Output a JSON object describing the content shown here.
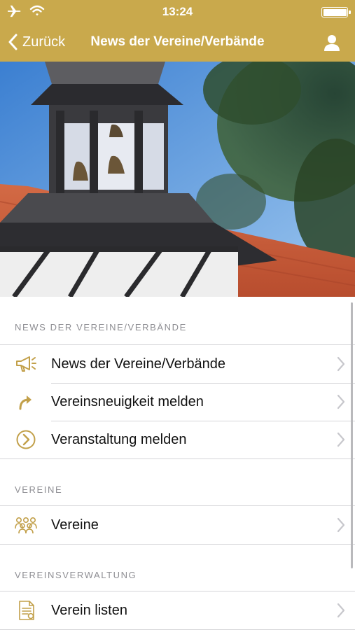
{
  "status_bar": {
    "time": "13:24"
  },
  "nav": {
    "back_label": "Zurück",
    "title": "News der Vereine/Verbände"
  },
  "colors": {
    "brand_gold": "#c9a94c",
    "icon_gold": "#c2a04a",
    "chevron": "#c7c7cc",
    "section_text": "#8e8e93"
  },
  "sections": [
    {
      "header": "NEWS DER VEREINE/VERBÄNDE",
      "items": [
        {
          "label": "News der Vereine/Verbände",
          "icon": "megaphone-icon"
        },
        {
          "label": "Vereinsneuigkeit melden",
          "icon": "share-arrow-icon"
        },
        {
          "label": "Veranstaltung melden",
          "icon": "circle-chevron-icon"
        }
      ]
    },
    {
      "header": "VEREINE",
      "items": [
        {
          "label": "Vereine",
          "icon": "group-icon"
        }
      ]
    },
    {
      "header": "VEREINSVERWALTUNG",
      "items": [
        {
          "label": "Verein listen",
          "icon": "document-list-icon"
        }
      ]
    }
  ]
}
